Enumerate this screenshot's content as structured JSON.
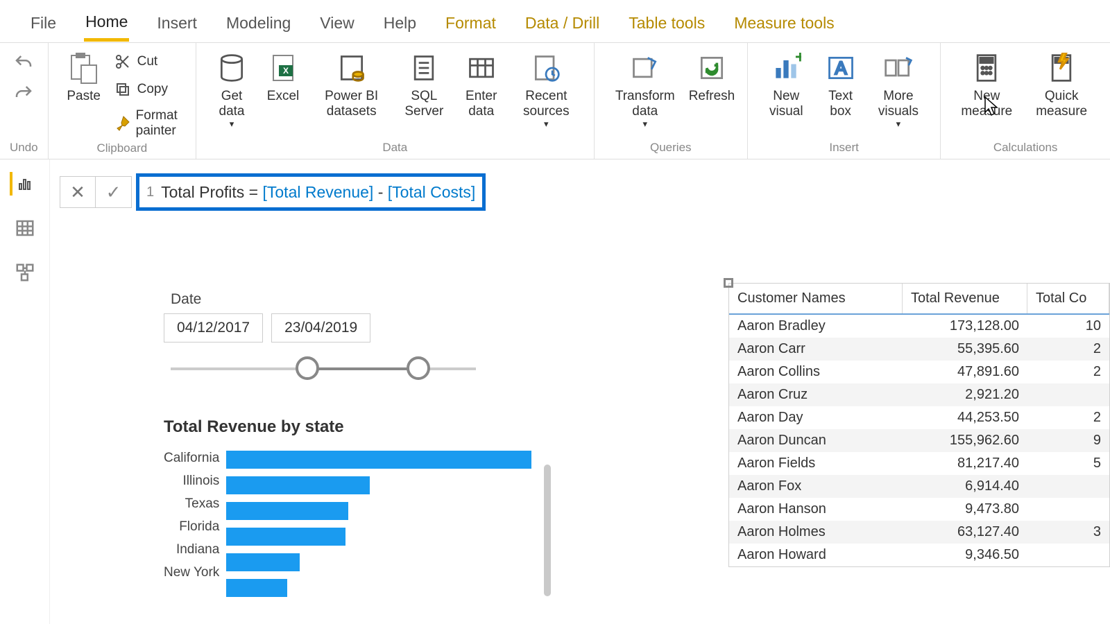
{
  "tabs": [
    "File",
    "Home",
    "Insert",
    "Modeling",
    "View",
    "Help",
    "Format",
    "Data / Drill",
    "Table tools",
    "Measure tools"
  ],
  "ribbon": {
    "undo": "Undo",
    "paste": "Paste",
    "cut": "Cut",
    "copy": "Copy",
    "fmtpainter": "Format painter",
    "clipboard": "Clipboard",
    "getdata": "Get data",
    "excel": "Excel",
    "pbids": "Power BI datasets",
    "sql": "SQL Server",
    "enter": "Enter data",
    "recent": "Recent sources",
    "data": "Data",
    "transform": "Transform data",
    "refresh": "Refresh",
    "queries": "Queries",
    "newvis": "New visual",
    "textbox": "Text box",
    "morervis": "More visuals",
    "insert": "Insert",
    "newmeasure": "New measure",
    "quickmeasure": "Quick measure",
    "calc": "Calculations"
  },
  "formula": {
    "line": "1",
    "name": "Total Profits",
    "eq": " = ",
    "m1": "[Total Revenue]",
    "minus": " - ",
    "m2": "[Total Costs]"
  },
  "slicer": {
    "label": "Date",
    "from": "04/12/2017",
    "to": "23/04/2019"
  },
  "chart_data": {
    "type": "bar",
    "title": "Total Revenue by state",
    "categories": [
      "California",
      "Illinois",
      "Texas",
      "Florida",
      "Indiana",
      "New York"
    ],
    "values": [
      100,
      47,
      40,
      39,
      24,
      20
    ],
    "xlabel": "",
    "ylabel": ""
  },
  "table": {
    "headers": [
      "Customer Names",
      "Total Revenue",
      "Total Co"
    ],
    "rows": [
      [
        "Aaron Bradley",
        "173,128.00",
        "10"
      ],
      [
        "Aaron Carr",
        "55,395.60",
        "2"
      ],
      [
        "Aaron Collins",
        "47,891.60",
        "2"
      ],
      [
        "Aaron Cruz",
        "2,921.20",
        ""
      ],
      [
        "Aaron Day",
        "44,253.50",
        "2"
      ],
      [
        "Aaron Duncan",
        "155,962.60",
        "9"
      ],
      [
        "Aaron Fields",
        "81,217.40",
        "5"
      ],
      [
        "Aaron Fox",
        "6,914.40",
        ""
      ],
      [
        "Aaron Hanson",
        "9,473.80",
        ""
      ],
      [
        "Aaron Holmes",
        "63,127.40",
        "3"
      ],
      [
        "Aaron Howard",
        "9,346.50",
        ""
      ]
    ]
  }
}
